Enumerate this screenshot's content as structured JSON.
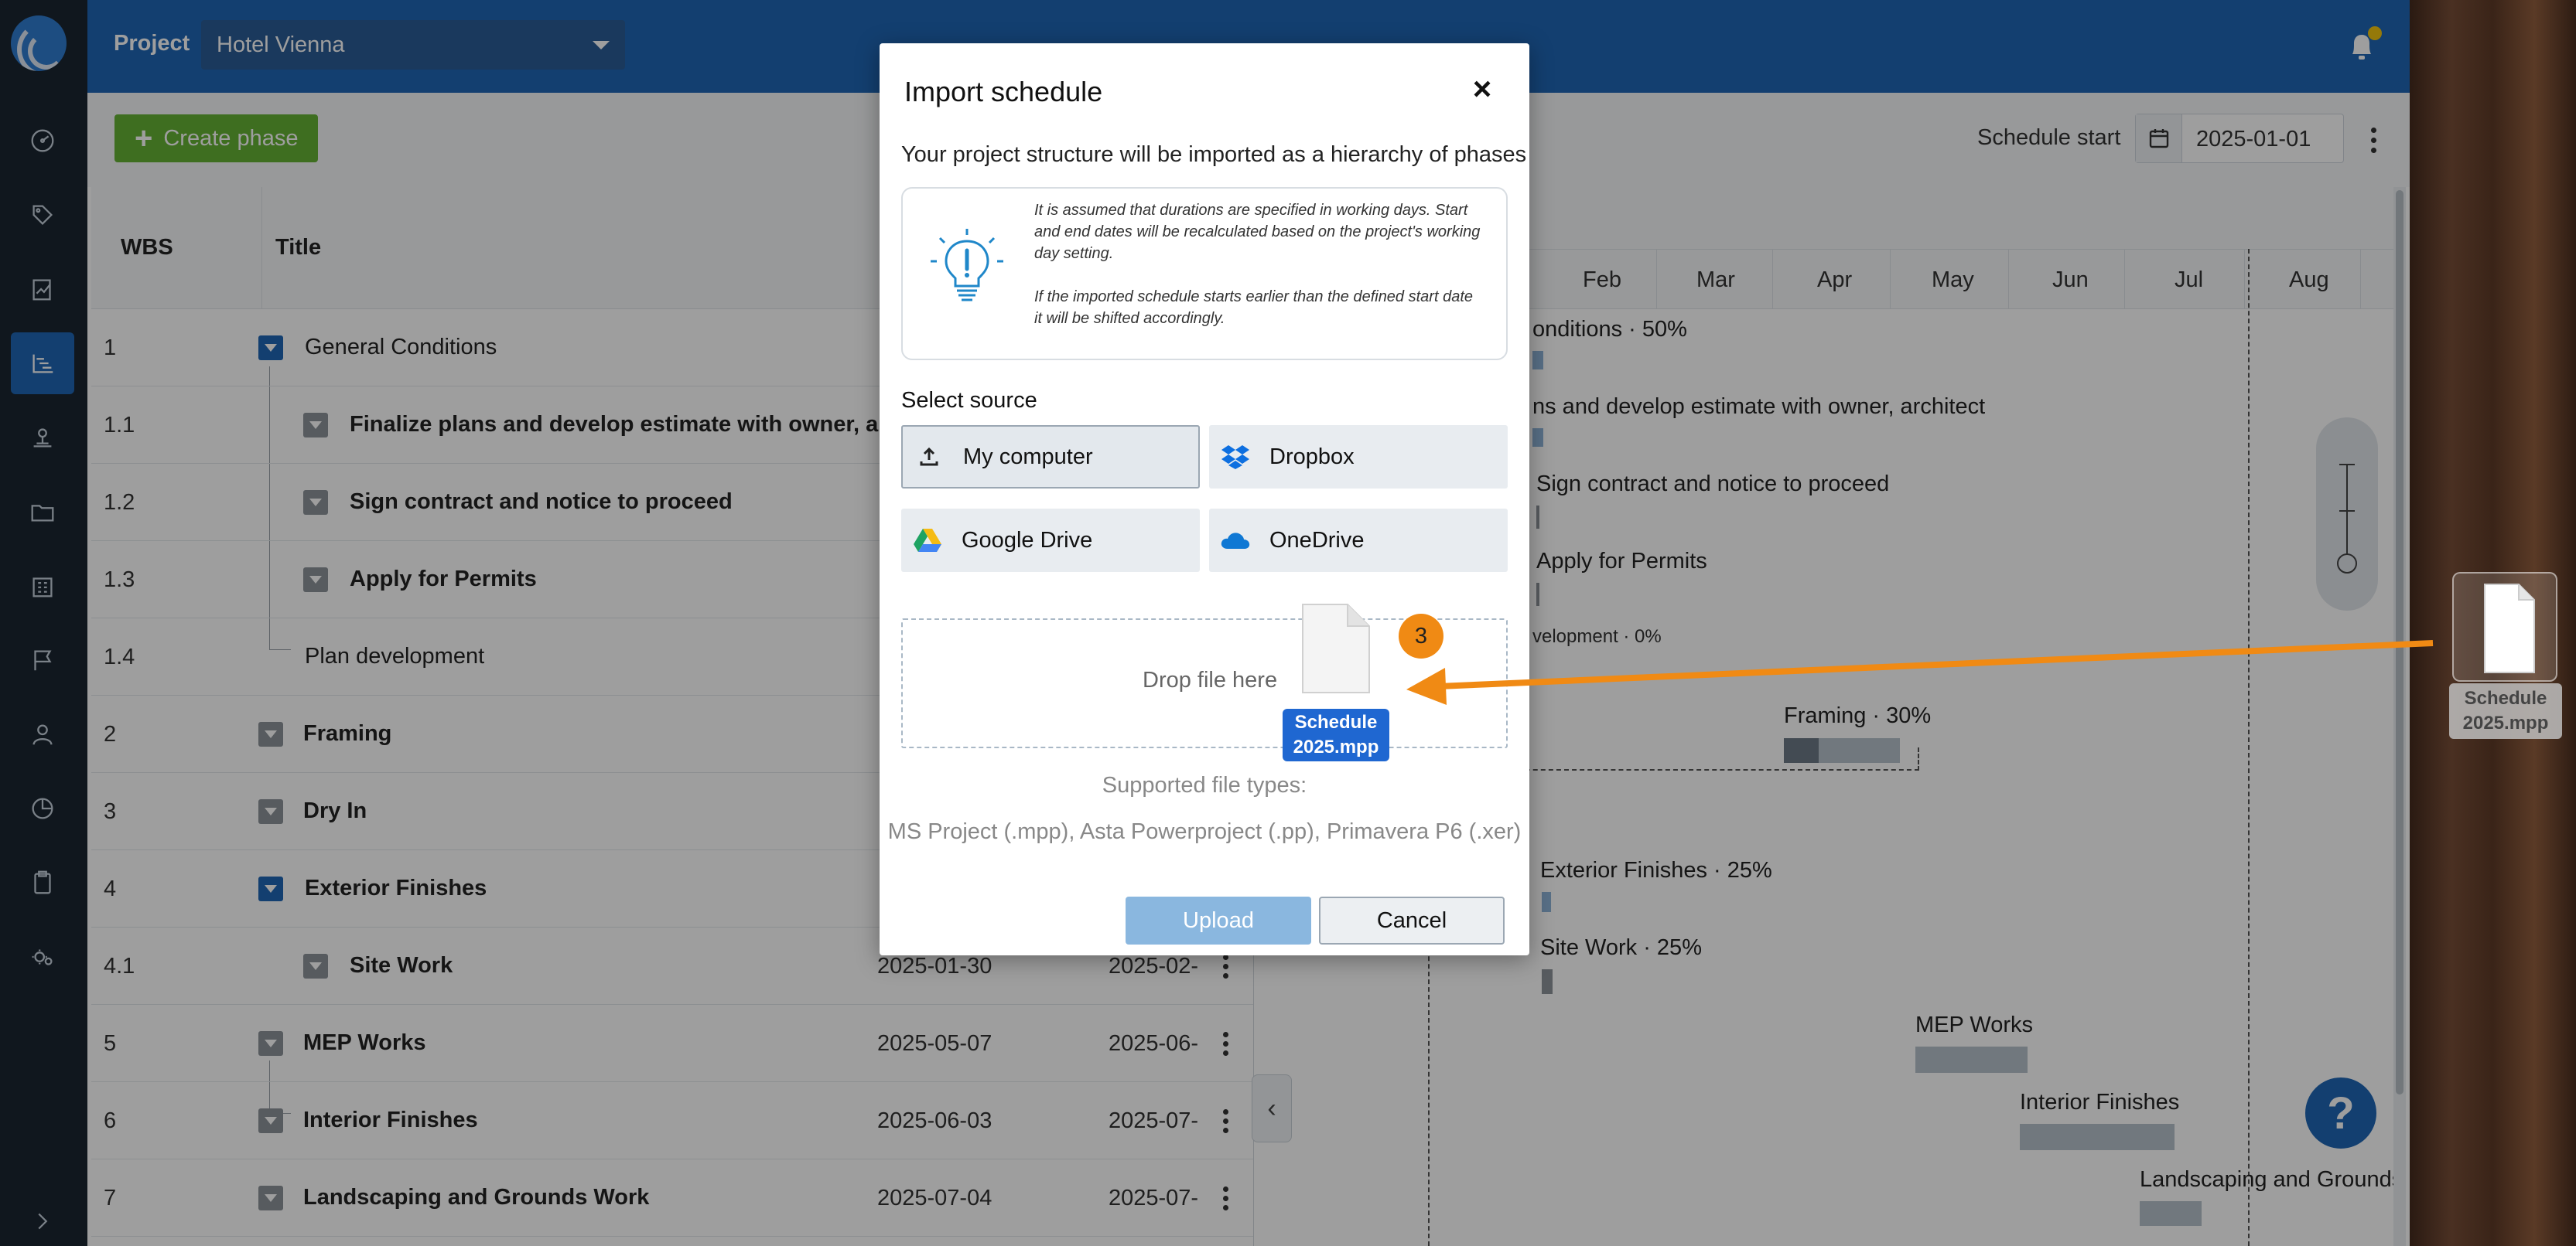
{
  "topbar": {
    "project_label": "Project",
    "project_value": "Hotel Vienna"
  },
  "toolbar": {
    "create_phase": "Create phase",
    "schedule_start_label": "Schedule start",
    "schedule_start_value": "2025-01-01"
  },
  "table": {
    "col_wbs": "WBS",
    "col_title": "Title",
    "rows": [
      {
        "wbs": "1",
        "title": "General Conditions",
        "start": "",
        "end": ""
      },
      {
        "wbs": "1.1",
        "title": "Finalize plans and develop estimate with owner, arc...",
        "start": "",
        "end": ""
      },
      {
        "wbs": "1.2",
        "title": "Sign contract and notice to proceed",
        "start": "",
        "end": ""
      },
      {
        "wbs": "1.3",
        "title": "Apply for Permits",
        "start": "",
        "end": ""
      },
      {
        "wbs": "1.4",
        "title": "Plan development",
        "start": "",
        "end": ""
      },
      {
        "wbs": "2",
        "title": "Framing",
        "start": "",
        "end": ""
      },
      {
        "wbs": "3",
        "title": "Dry In",
        "start": "",
        "end": ""
      },
      {
        "wbs": "4",
        "title": "Exterior Finishes",
        "start": "",
        "end": ""
      },
      {
        "wbs": "4.1",
        "title": "Site Work",
        "start": "2025-01-30",
        "end": "2025-02-"
      },
      {
        "wbs": "5",
        "title": "MEP Works",
        "start": "2025-05-07",
        "end": "2025-06-"
      },
      {
        "wbs": "6",
        "title": "Interior Finishes",
        "start": "2025-06-03",
        "end": "2025-07-"
      },
      {
        "wbs": "7",
        "title": "Landscaping and Grounds Work",
        "start": "2025-07-04",
        "end": "2025-07-"
      }
    ]
  },
  "gantt": {
    "months": [
      "Feb",
      "Mar",
      "Apr",
      "May",
      "Jun",
      "Jul",
      "Aug"
    ],
    "labels": {
      "general": "onditions · 50%",
      "finalize": "ns and develop estimate with owner, architect",
      "sign": "Sign contract and notice to proceed",
      "permits": "Apply for Permits",
      "plandev": "velopment · 0%",
      "framing": "Framing · 30%",
      "exterior": "Exterior Finishes · 25%",
      "site": "Site Work · 25%",
      "mep": "MEP Works",
      "interior": "Interior Finishes",
      "landscaping": "Landscaping and Grounds"
    }
  },
  "modal": {
    "title": "Import schedule",
    "close": "×",
    "subtitle": "Your project structure will be imported as a hierarchy of phases",
    "info_p1": "It is assumed that durations are specified in working days. Start and end dates will be recalculated based on the project's working day setting.",
    "info_p2": "If the imported schedule starts earlier than the defined start date it will be shifted accordingly.",
    "select_source": "Select source",
    "sources": {
      "my_computer": "My computer",
      "dropbox": "Dropbox",
      "google_drive": "Google Drive",
      "onedrive": "OneDrive"
    },
    "drop_text": "Drop file here",
    "supported_label": "Supported file types:",
    "supported_types": "MS Project (.mpp), Asta Powerproject (.pp), Primavera P6 (.xer)",
    "upload": "Upload",
    "cancel": "Cancel"
  },
  "drag": {
    "file_line1": "Schedule",
    "file_line2": "2025.mpp",
    "count": "3"
  },
  "desktop": {
    "file_line1": "Schedule",
    "file_line2": "2025.mpp"
  },
  "help": "?",
  "colors": {
    "primary": "#1f67b5",
    "accent_green": "#64b234",
    "drag_arrow": "#f08a14"
  }
}
